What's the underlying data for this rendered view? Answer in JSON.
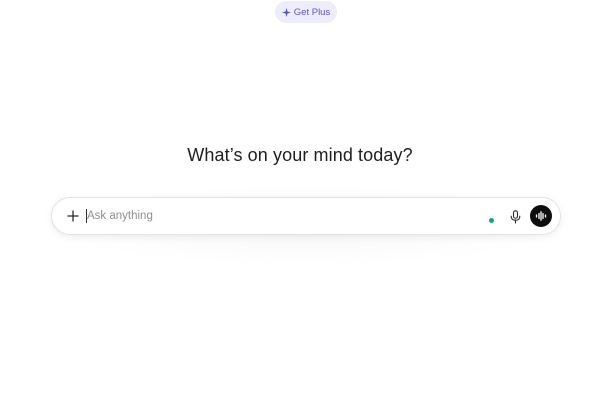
{
  "header": {
    "upgrade_label": "Get Plus",
    "upgrade_icon": "sparkle-icon"
  },
  "main": {
    "heading": "What’s on your mind today?"
  },
  "composer": {
    "placeholder": "Ask anything",
    "value": "",
    "attach_icon": "plus-icon",
    "mic_icon": "microphone-icon",
    "voice_icon": "voice-waveform-icon",
    "status_color": "#10a37f"
  },
  "colors": {
    "accent": "#5b55c9",
    "accent_bg": "#eeedfb",
    "voice_button_bg": "#0d0d0d"
  }
}
